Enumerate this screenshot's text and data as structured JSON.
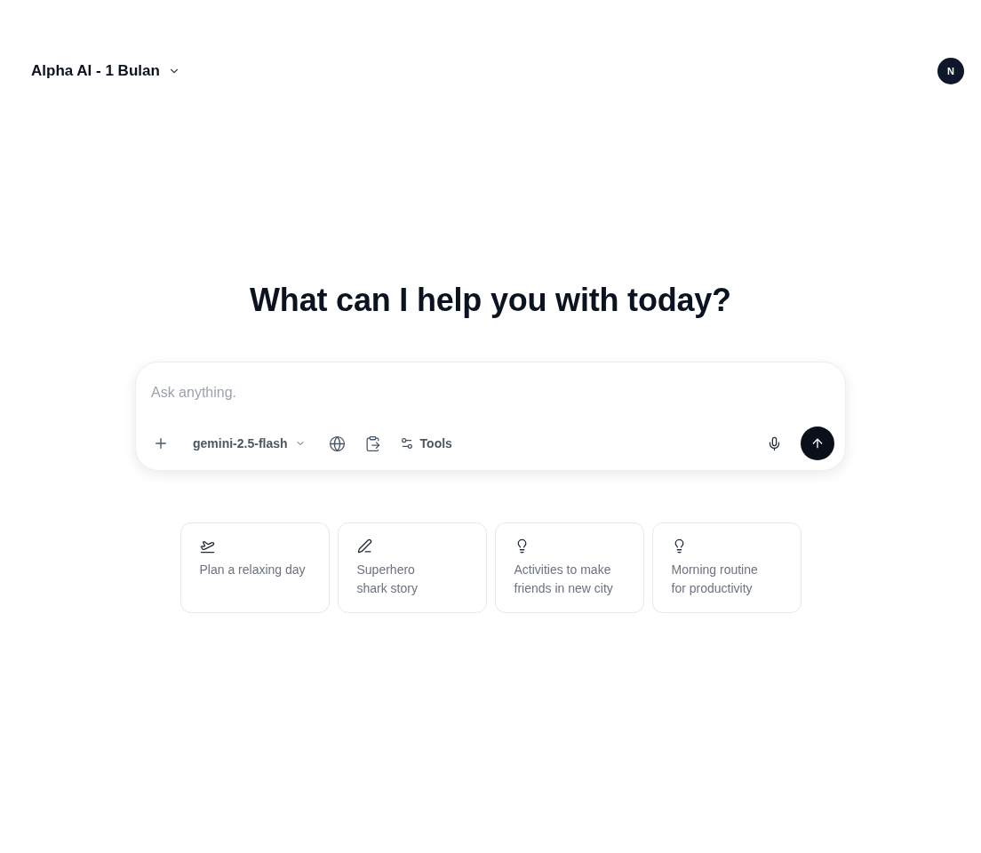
{
  "header": {
    "title": "Alpha AI - 1 Bulan",
    "avatar": "N"
  },
  "heading": "What can I help you with today?",
  "composer": {
    "placeholder": "Ask anything.",
    "model": "gemini-2.5-flash",
    "tools_label": "Tools"
  },
  "suggestions": [
    {
      "kind": "plane",
      "text": "Plan a relaxing day"
    },
    {
      "kind": "pen",
      "text": "Superhero shark story"
    },
    {
      "kind": "bulb",
      "text": "Activities to make friends in new city"
    },
    {
      "kind": "bulb",
      "text": "Morning routine for productivity"
    }
  ]
}
